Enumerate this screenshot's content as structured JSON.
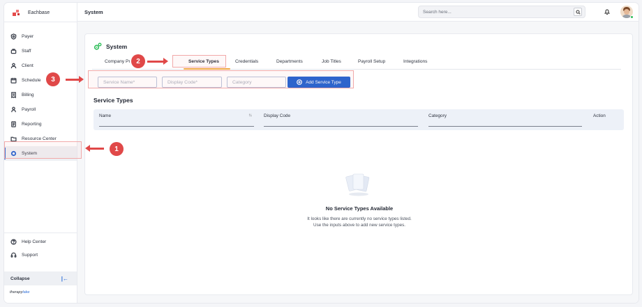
{
  "brand": {
    "name": "Eachbase",
    "footer_prefix": "therapy",
    "footer_suffix": "lake"
  },
  "sidebar": {
    "items": [
      {
        "label": "Payer",
        "icon": "shield-icon"
      },
      {
        "label": "Staff",
        "icon": "staff-icon"
      },
      {
        "label": "Client",
        "icon": "client-icon"
      },
      {
        "label": "Schedule",
        "icon": "calendar-icon"
      },
      {
        "label": "Billing",
        "icon": "billing-icon"
      },
      {
        "label": "Payroll",
        "icon": "payroll-icon"
      },
      {
        "label": "Reporting",
        "icon": "report-icon"
      },
      {
        "label": "Resource Center",
        "icon": "folder-icon"
      },
      {
        "label": "System",
        "icon": "system-icon",
        "active": true
      }
    ],
    "bottom": [
      {
        "label": "Help Center",
        "icon": "help-icon"
      },
      {
        "label": "Support",
        "icon": "headset-icon"
      }
    ],
    "collapse_label": "Collapse"
  },
  "header": {
    "title": "System",
    "search_placeholder": "Search here..."
  },
  "page": {
    "title": "System",
    "tabs": [
      "Company Pr",
      "Service Types",
      "Credentials",
      "Departments",
      "Job Titles",
      "Payroll Setup",
      "Integrations"
    ],
    "active_tab": "Service Types",
    "form": {
      "service_name_placeholder": "Service Name*",
      "display_code_placeholder": "Display Code*",
      "category_placeholder": "Category",
      "add_button": "Add Service Type"
    },
    "section_title": "Service Types",
    "table": {
      "columns": [
        "Name",
        "Display Code",
        "Category",
        "Action"
      ],
      "sort_icon": "↑↓"
    },
    "empty": {
      "title": "No Service Types Available",
      "line1": "It looks like there are currently no service types listed.",
      "line2": "Use the inputs above to add new service types."
    }
  },
  "annotations": {
    "badge1": "1",
    "badge2": "2",
    "badge3": "3"
  },
  "colors": {
    "accent": "#1e5fd0",
    "annotation": "#e04848",
    "tab_underline": "#f0a441",
    "gear": "#2ebd59"
  }
}
